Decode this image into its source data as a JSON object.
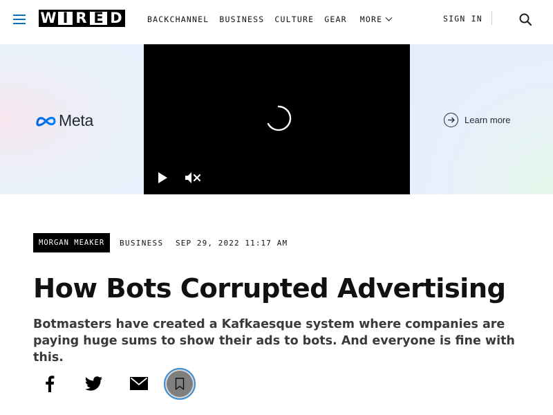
{
  "header": {
    "logo_letters": [
      "W",
      "I",
      "R",
      "E",
      "D"
    ],
    "nav": {
      "items": [
        "BACKCHANNEL",
        "BUSINESS",
        "CULTURE",
        "GEAR"
      ],
      "more_label": "MORE"
    },
    "signin_label": "SIGN IN",
    "brand_color": "#0b6fb8"
  },
  "ad": {
    "advertiser": "Meta",
    "cta_label": "Learn more"
  },
  "article": {
    "author": "MORGAN MEAKER",
    "category": "BUSINESS",
    "date": "SEP 29, 2022 11:17 AM",
    "headline": "How Bots Corrupted Advertising",
    "dek": "Botmasters have created a Kafkaesque system where companies are paying huge sums to show their ads to bots. And everyone is fine with this."
  },
  "share": {
    "icons": [
      "facebook-icon",
      "twitter-icon",
      "email-icon",
      "bookmark-icon"
    ]
  }
}
